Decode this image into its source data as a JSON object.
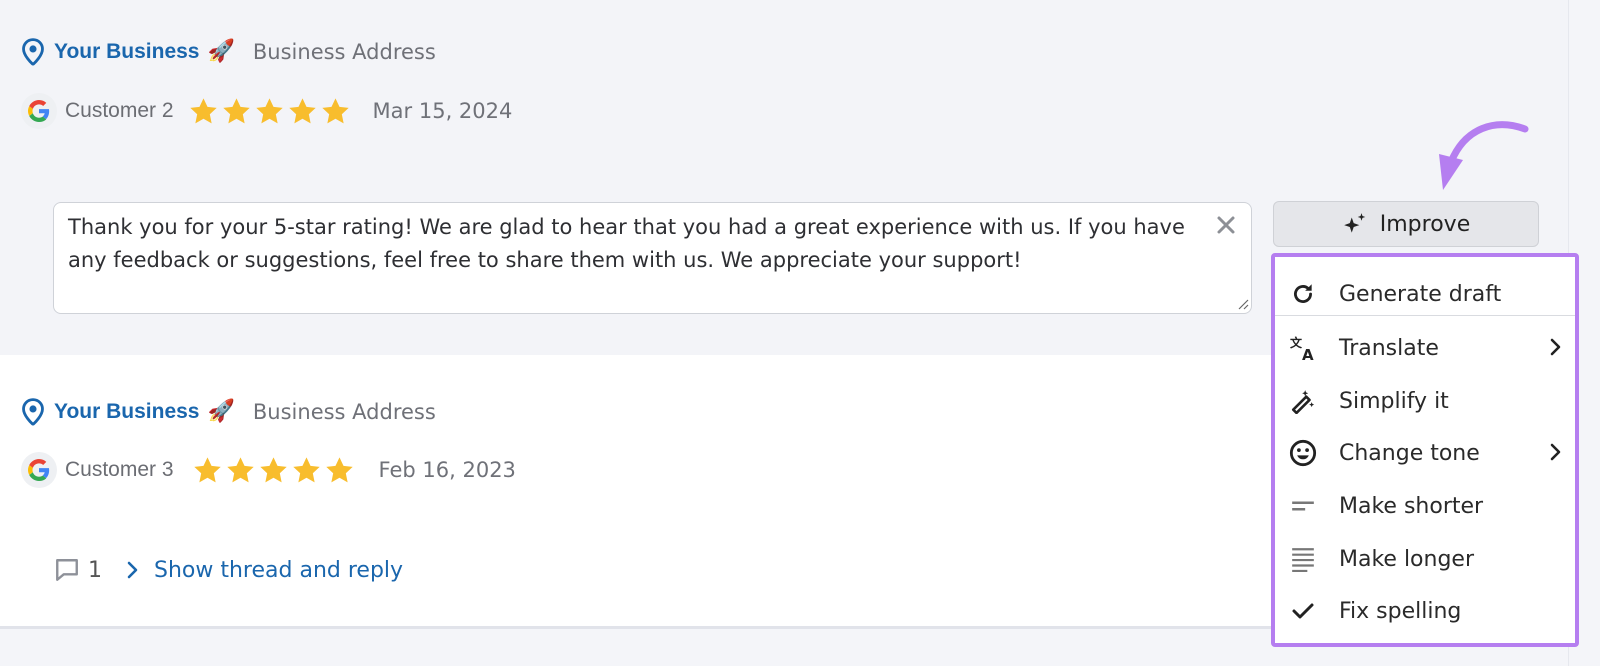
{
  "reviews": [
    {
      "business_name": "Your Business",
      "business_emoji": "🚀",
      "business_address": "Business Address",
      "customer": "Customer 2",
      "rating": 5,
      "date": "Mar 15, 2024",
      "reply_text": "Thank you for your 5-star rating! We are glad to hear that you had a great experience with us. If you have any feedback or suggestions, feel free to share them with us. We appreciate your support!"
    },
    {
      "business_name": "Your Business",
      "business_emoji": "🚀",
      "business_address": "Business Address",
      "customer": "Customer 3",
      "rating": 5,
      "date": "Feb 16, 2023",
      "comment_count": "1",
      "thread_link": "Show thread and reply"
    }
  ],
  "improve": {
    "button_label": "Improve",
    "menu": [
      {
        "label": "Generate draft",
        "icon": "refresh-icon"
      },
      {
        "label": "Translate",
        "icon": "translate-icon",
        "submenu": true
      },
      {
        "label": "Simplify it",
        "icon": "magic-wand-icon"
      },
      {
        "label": "Change tone",
        "icon": "smiley-icon",
        "submenu": true
      },
      {
        "label": "Make shorter",
        "icon": "short-lines-icon"
      },
      {
        "label": "Make longer",
        "icon": "long-lines-icon"
      },
      {
        "label": "Fix spelling",
        "icon": "check-icon"
      }
    ]
  },
  "colors": {
    "brand_blue": "#1a66ad",
    "star": "#f8bd2d",
    "highlight_purple": "#b57ef0"
  }
}
